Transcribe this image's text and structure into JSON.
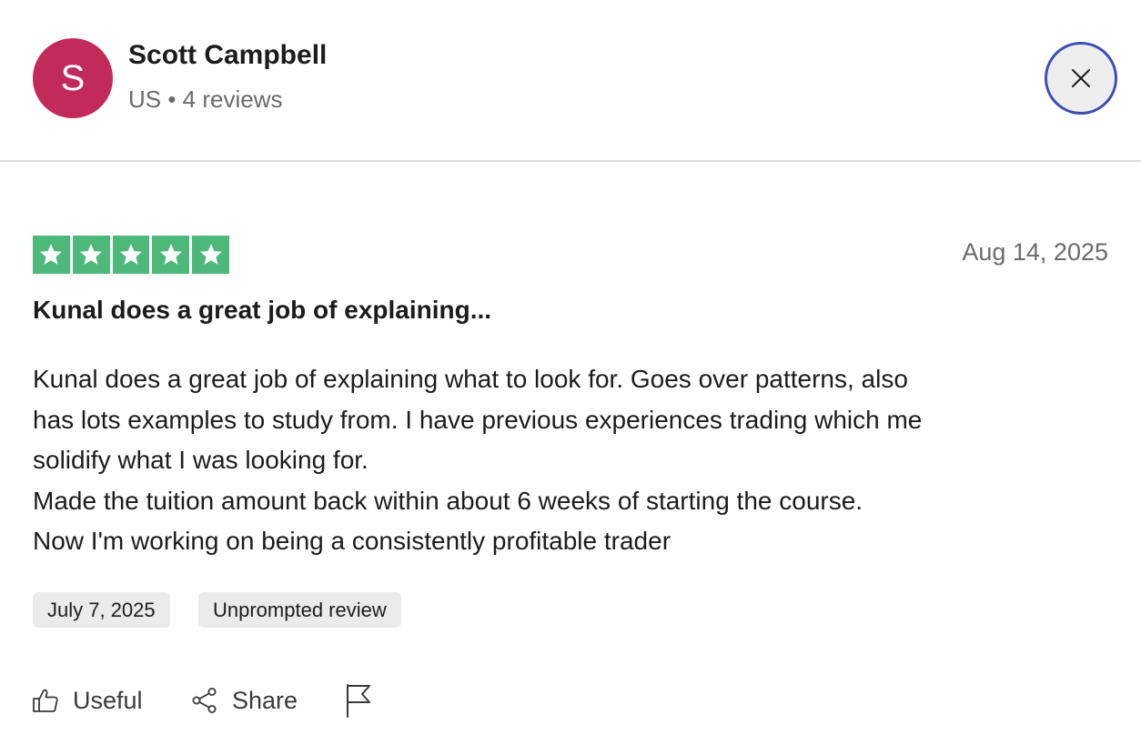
{
  "reviewer": {
    "initial": "S",
    "name": "Scott Campbell",
    "meta": "US • 4 reviews",
    "avatar_color": "#c22a5a"
  },
  "close": {
    "icon": "close-icon"
  },
  "review": {
    "rating": 5,
    "max_rating": 5,
    "star_color": "#4cb97a",
    "date": "Aug 14, 2025",
    "title": "Kunal does a great job of explaining...",
    "body_lines": [
      "Kunal does a great job of explaining what to look for. Goes over patterns, also",
      "has lots examples to study from. I have previous experiences trading which me",
      "solidify what I was looking for.",
      "Made the tuition amount back within about 6 weeks of starting the course.",
      "Now I'm working on being a consistently profitable trader"
    ],
    "tags": {
      "experience_date": "July 7, 2025",
      "review_type": "Unprompted review"
    }
  },
  "actions": {
    "useful": {
      "label": "Useful",
      "icon": "thumbs-up-icon"
    },
    "share": {
      "label": "Share",
      "icon": "share-icon"
    },
    "report": {
      "icon": "flag-icon"
    }
  },
  "colors": {
    "accent_focus": "#3a4fb5",
    "text_primary": "#1c1c1c",
    "text_secondary": "#6b6b6b",
    "chip_bg": "#ebebeb"
  }
}
